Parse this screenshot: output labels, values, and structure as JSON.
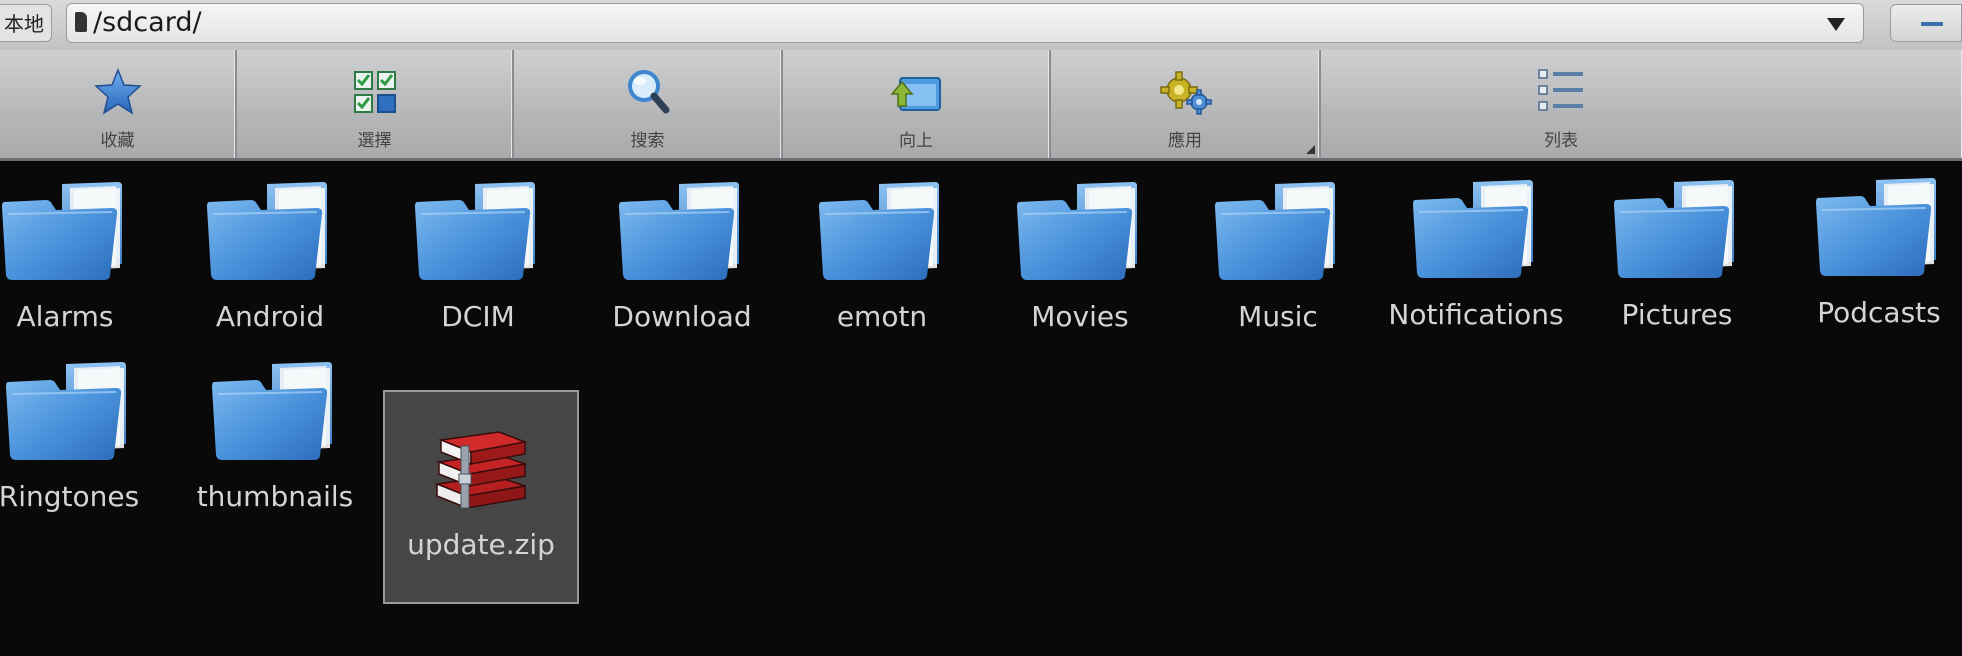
{
  "topbar": {
    "local_label": "本地",
    "path": "/sdcard/"
  },
  "toolbar": {
    "buttons": [
      {
        "label": "收藏",
        "icon": "star-icon"
      },
      {
        "label": "選擇",
        "icon": "select-grid-icon"
      },
      {
        "label": "搜索",
        "icon": "magnifier-icon"
      },
      {
        "label": "向上",
        "icon": "up-folder-icon"
      },
      {
        "label": "應用",
        "icon": "gears-icon"
      },
      {
        "label": "列表",
        "icon": "list-view-icon"
      }
    ]
  },
  "files": [
    {
      "name": "Alarms",
      "type": "folder"
    },
    {
      "name": "Android",
      "type": "folder"
    },
    {
      "name": "DCIM",
      "type": "folder"
    },
    {
      "name": "Download",
      "type": "folder"
    },
    {
      "name": "emotn",
      "type": "folder"
    },
    {
      "name": "Movies",
      "type": "folder"
    },
    {
      "name": "Music",
      "type": "folder"
    },
    {
      "name": "Notifications",
      "type": "folder"
    },
    {
      "name": "Pictures",
      "type": "folder"
    },
    {
      "name": "Podcasts",
      "type": "folder"
    },
    {
      "name": "Ringtones",
      "type": "folder"
    },
    {
      "name": "thumbnails",
      "type": "folder"
    },
    {
      "name": "update.zip",
      "type": "zip",
      "selected": true
    }
  ],
  "colors": {
    "background": "#0a0909",
    "folder_blue": "#3f86d4",
    "toolbar": "#bcbdbf",
    "selection": "#6f6f6f"
  }
}
